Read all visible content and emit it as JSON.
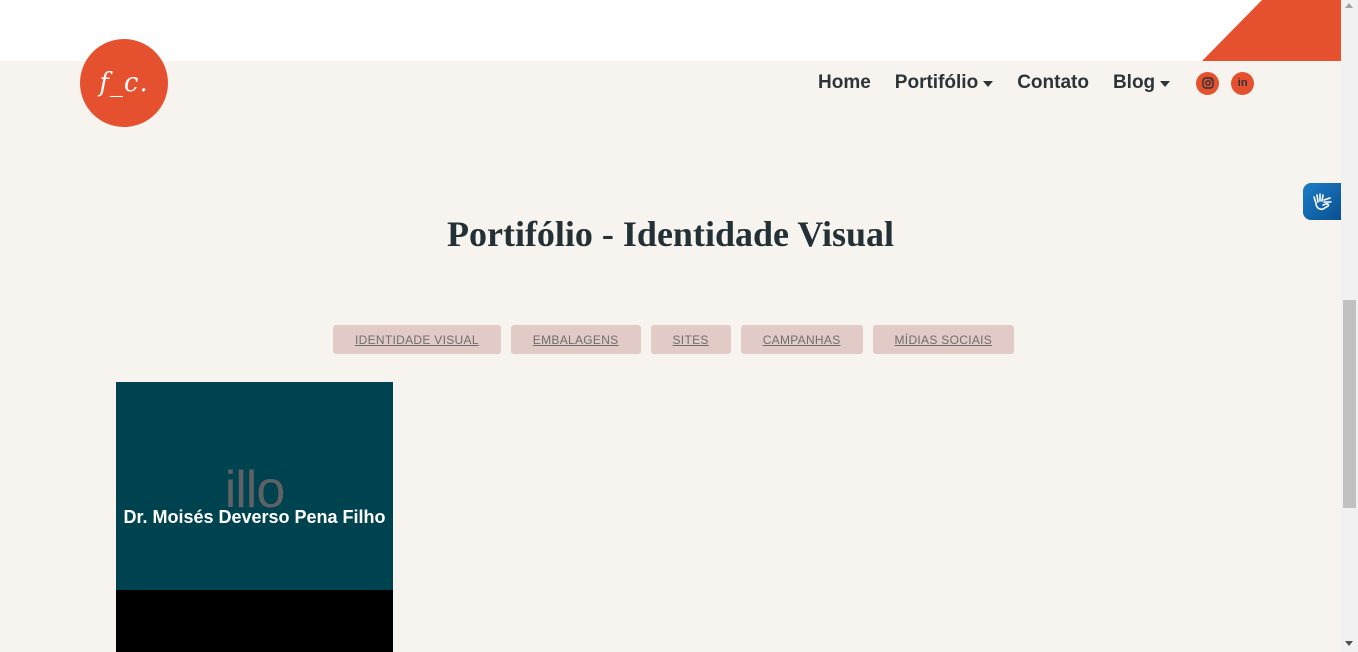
{
  "logo": {
    "text": "f_c."
  },
  "nav": {
    "items": [
      {
        "label": "Home",
        "dropdown": false
      },
      {
        "label": "Portifólio",
        "dropdown": true
      },
      {
        "label": "Contato",
        "dropdown": false
      },
      {
        "label": "Blog",
        "dropdown": true
      }
    ],
    "social": [
      {
        "icon": "instagram-icon"
      },
      {
        "icon": "linkedin-icon",
        "text": "in"
      }
    ]
  },
  "page": {
    "title": "Portifólio - Identidade Visual"
  },
  "filters": [
    "IDENTIDADE VISUAL",
    "EMBALAGENS",
    "SITES",
    "CAMPANHAS",
    "MÍDIAS SOCIAIS"
  ],
  "portfolio": {
    "items": [
      {
        "watermark": "illo",
        "title": "Dr. Moisés Deverso Pena Filho"
      }
    ]
  },
  "accessibility": {
    "icon": "sign-language-icon"
  },
  "colors": {
    "accent": "#e5512f",
    "background": "#f7f4ef",
    "card": "#004350",
    "filter": "#e2cbc6",
    "text": "#233035"
  }
}
